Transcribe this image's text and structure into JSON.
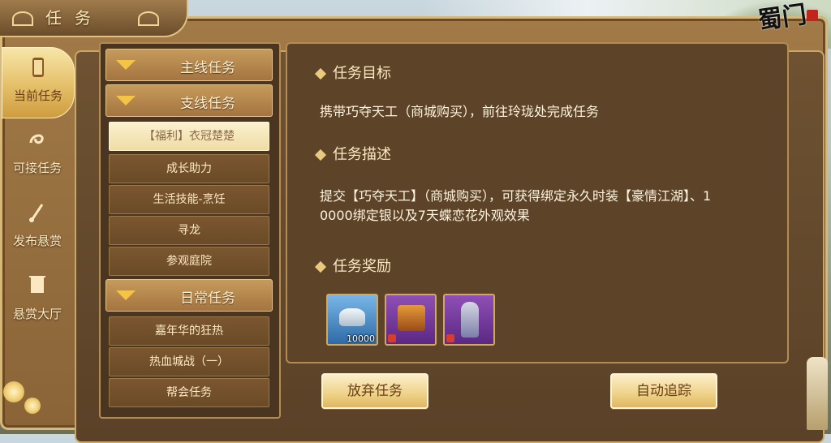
{
  "window": {
    "title": "任务"
  },
  "logo": {
    "text": "蜀门"
  },
  "side_tabs": [
    {
      "label": "当前任务",
      "icon": "scroll-icon",
      "active": true
    },
    {
      "label": "可接任务",
      "icon": "swirl-icon",
      "active": false
    },
    {
      "label": "发布悬赏",
      "icon": "brush-icon",
      "active": false
    },
    {
      "label": "悬赏大厅",
      "icon": "banner-icon",
      "active": false
    }
  ],
  "quest_list": {
    "categories": [
      {
        "label": "主线任务"
      },
      {
        "label": "支线任务"
      },
      {
        "label": "日常任务"
      }
    ],
    "branch_items": [
      {
        "label": "【福利】衣冠楚楚",
        "selected": true
      },
      {
        "label": "成长助力",
        "selected": false
      },
      {
        "label": "生活技能-烹饪",
        "selected": false
      },
      {
        "label": "寻龙",
        "selected": false
      },
      {
        "label": "参观庭院",
        "selected": false
      }
    ],
    "daily_items": [
      {
        "label": "嘉年华的狂热"
      },
      {
        "label": "热血城战（一）"
      },
      {
        "label": "帮会任务"
      }
    ]
  },
  "detail": {
    "goal_title": "任务目标",
    "goal_text": "携带巧夺天工（商城购买），前往玲珑处完成任务",
    "desc_title": "任务描述",
    "desc_line1": "提交【巧夺天工】（商城购买），可获得绑定永久时装【豪情江湖】、1",
    "desc_line2": "0000绑定银以及7天蝶恋花外观效果",
    "reward_title": "任务奖励",
    "rewards": [
      {
        "icon": "silver-ingot-icon",
        "quantity": "10000",
        "locked": true
      },
      {
        "icon": "gift-chest-icon",
        "quantity": "",
        "locked": true
      },
      {
        "icon": "costume-figure-icon",
        "quantity": "",
        "locked": true
      }
    ]
  },
  "buttons": {
    "abandon": "放弃任务",
    "auto_track": "自动追踪"
  },
  "colors": {
    "frame": "#8a6437",
    "panel": "#5d4328",
    "accent_gold": "#f0d48c",
    "text_light": "#fdf3df"
  }
}
